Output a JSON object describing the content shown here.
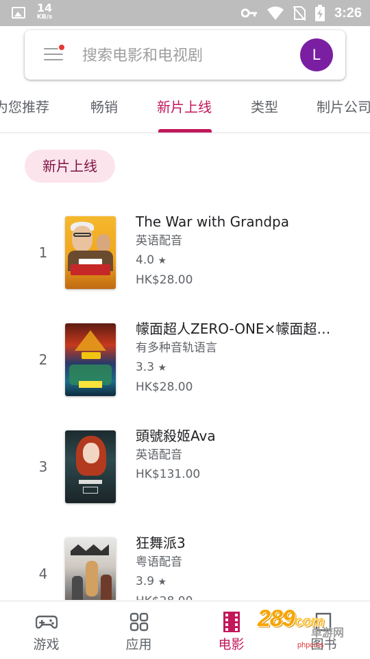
{
  "status_bar": {
    "speed_value": "14",
    "speed_unit": "KB/s",
    "time": "3:26",
    "icons": [
      "gallery-icon",
      "key-icon",
      "wifi-icon",
      "no-sim-icon",
      "battery-charging-icon"
    ]
  },
  "search": {
    "placeholder": "搜索电影和电视剧",
    "avatar_letter": "L",
    "menu_icon": "menu-icon",
    "colors": {
      "avatar": "#7b1fa2",
      "notification_dot": "#e53935"
    }
  },
  "tabs": [
    {
      "label": "为您推荐",
      "active": false
    },
    {
      "label": "畅销",
      "active": false
    },
    {
      "label": "新片上线",
      "active": true
    },
    {
      "label": "类型",
      "active": false
    },
    {
      "label": "制片公司",
      "active": false
    }
  ],
  "accent_color": "#c2185b",
  "filter_chip": {
    "label": "新片上线"
  },
  "movies": [
    {
      "rank": "1",
      "title": "The War with Grandpa",
      "audio": "英语配音",
      "rating": "4.0",
      "star": "★",
      "price": "HK$28.00"
    },
    {
      "rank": "2",
      "title": "幪面超人ZERO-ONE×幪面超人…",
      "audio": "有多种音轨语言",
      "rating": "3.3",
      "star": "★",
      "price": "HK$28.00"
    },
    {
      "rank": "3",
      "title": "頭號殺姬Ava",
      "audio": "英语配音",
      "rating": "",
      "star": "",
      "price": "HK$131.00"
    },
    {
      "rank": "4",
      "title": "狂舞派3",
      "audio": "粤语配音",
      "rating": "3.9",
      "star": "★",
      "price": "HK$28.00"
    }
  ],
  "bottom_nav": [
    {
      "label": "游戏",
      "icon": "gamepad-icon",
      "active": false
    },
    {
      "label": "应用",
      "icon": "apps-grid-icon",
      "active": false
    },
    {
      "label": "电影",
      "icon": "movie-film-icon",
      "active": true
    },
    {
      "label": "图书",
      "icon": "book-icon",
      "active": false
    }
  ],
  "watermark": {
    "number": "289",
    "suffix": "com",
    "net_label": "单游网",
    "small_text": "phpcms"
  }
}
